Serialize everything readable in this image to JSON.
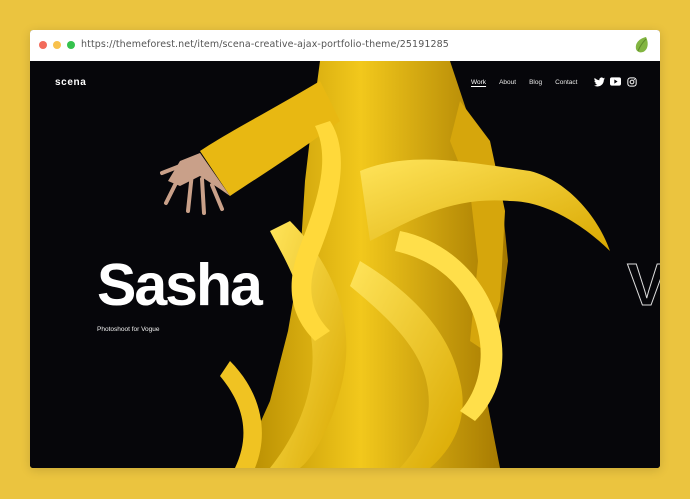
{
  "browser": {
    "url": "https://themeforest.net/item/scena-creative-ajax-portfolio-theme/25191285"
  },
  "site": {
    "logo": "scena",
    "nav": [
      {
        "label": "Work",
        "active": true
      },
      {
        "label": "About",
        "active": false
      },
      {
        "label": "Blog",
        "active": false
      },
      {
        "label": "Contact",
        "active": false
      }
    ],
    "socials": [
      "twitter-icon",
      "youtube-icon",
      "instagram-icon"
    ]
  },
  "hero": {
    "title": "Sasha",
    "subtitle": "Photoshoot for Vogue",
    "next_title_partial": "V"
  },
  "colors": {
    "frame_bg": "#ebc43f",
    "page_bg": "#06060a",
    "accent_yellow": "#f2c81c",
    "text": "#ffffff"
  }
}
